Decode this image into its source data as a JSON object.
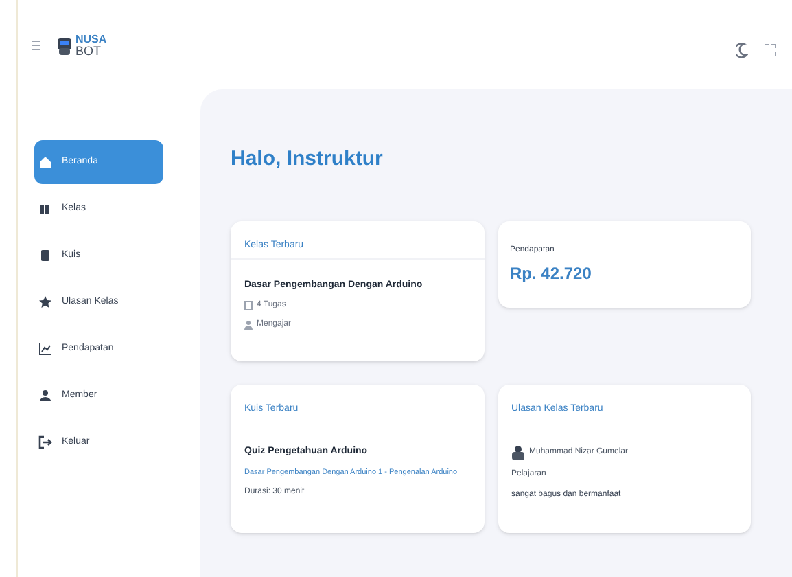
{
  "header": {
    "logo_top": "NUSA",
    "logo_bottom": "BOT"
  },
  "sidebar": {
    "items": [
      {
        "label": "Beranda",
        "selected": true
      },
      {
        "label": "Kelas",
        "selected": false
      },
      {
        "label": "Kuis",
        "selected": false
      },
      {
        "label": "Ulasan Kelas",
        "selected": false
      },
      {
        "label": "Pendapatan",
        "selected": false
      },
      {
        "label": "Member",
        "selected": false
      },
      {
        "label": "Keluar",
        "selected": false
      }
    ]
  },
  "greeting": "Halo, Instruktur",
  "latest_class": {
    "title": "Kelas Terbaru",
    "name": "Dasar Pengembangan Dengan Arduino",
    "tasks": "4 Tugas",
    "status": "Mengajar"
  },
  "income": {
    "title": "Pendapatan",
    "amount": "Rp. 42.720"
  },
  "latest_quiz": {
    "title": "Kuis Terbaru",
    "name": "Quiz Pengetahuan Arduino",
    "course": "Dasar Pengembangan Dengan Arduino 1 - Pengenalan Arduino",
    "duration": "Durasi: 30 menit"
  },
  "latest_review": {
    "title": "Ulasan Kelas Terbaru",
    "reviewer": "Muhammad Nizar Gumelar",
    "role": "Pelajaran",
    "comment": "sangat bagus dan bermanfaat"
  }
}
